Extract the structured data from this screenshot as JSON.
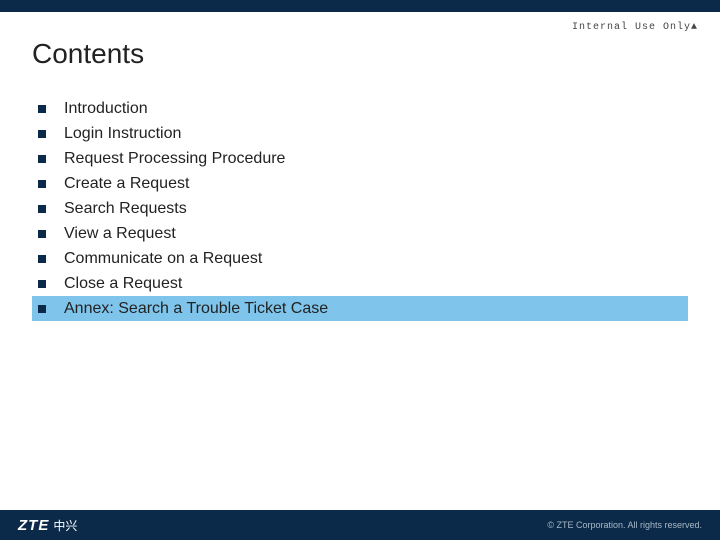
{
  "classification": "Internal Use Only▲",
  "title": "Contents",
  "items": [
    {
      "label": "Introduction",
      "highlight": false
    },
    {
      "label": "Login Instruction",
      "highlight": false
    },
    {
      "label": "Request Processing Procedure",
      "highlight": false
    },
    {
      "label": "Create a Request",
      "highlight": false
    },
    {
      "label": "Search Requests",
      "highlight": false
    },
    {
      "label": "View a Request",
      "highlight": false
    },
    {
      "label": "Communicate on a Request",
      "highlight": false
    },
    {
      "label": "Close a Request",
      "highlight": false
    },
    {
      "label": "Annex: Search a Trouble Ticket  Case",
      "highlight": true
    }
  ],
  "footer": {
    "logo_text": "ZTE",
    "logo_cn": "中兴",
    "copyright": "© ZTE Corporation. All rights reserved."
  }
}
